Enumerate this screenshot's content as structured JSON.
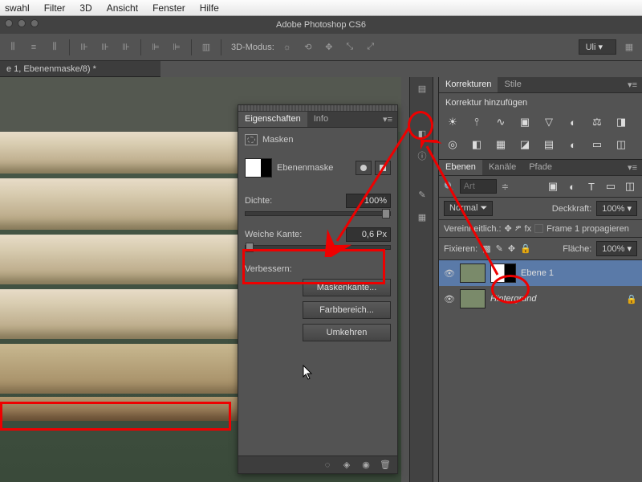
{
  "menubar": {
    "items": [
      "swahl",
      "Filter",
      "3D",
      "Ansicht",
      "Fenster",
      "Hilfe"
    ]
  },
  "app_title": "Adobe Photoshop CS6",
  "optionsbar": {
    "mode_label": "3D-Modus:",
    "user": "Uli"
  },
  "doc_tab": "e 1, Ebenenmaske/8) *",
  "props": {
    "tabs": {
      "eigenschaften": "Eigenschaften",
      "info": "Info"
    },
    "header": "Masken",
    "mask_name": "Ebenenmaske",
    "dichte_label": "Dichte:",
    "dichte_value": "100%",
    "weiche_label": "Weiche Kante:",
    "weiche_value": "0,6 Px",
    "verbessern_label": "Verbessern:",
    "btn_maskenkante": "Maskenkante...",
    "btn_farbbereich": "Farbbereich...",
    "btn_umkehren": "Umkehren"
  },
  "adjustments": {
    "tabs": {
      "korrekturen": "Korrekturen",
      "stile": "Stile"
    },
    "subtitle": "Korrektur hinzufügen"
  },
  "layers": {
    "tabs": {
      "ebenen": "Ebenen",
      "kanale": "Kanäle",
      "pfade": "Pfade"
    },
    "search_placeholder": "Art",
    "blend_mode": "Normal",
    "deckkraft_label": "Deckkraft:",
    "deckkraft_value": "100%",
    "vereinheit": "Vereinheitlich.:",
    "frame_prop": "Frame 1 propagieren",
    "fixieren_label": "Fixieren:",
    "flaeche_label": "Fläche:",
    "flaeche_value": "100%",
    "layer1": "Ebene 1",
    "background": "Hintergrund"
  }
}
